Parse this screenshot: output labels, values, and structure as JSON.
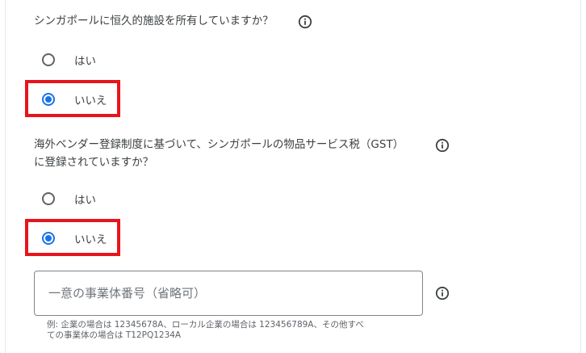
{
  "colors": {
    "accent": "#1a73e8",
    "highlight_border": "#e8141c",
    "text": "#3c4043",
    "secondary_text": "#5f6368"
  },
  "q1": {
    "text": "シンガポールに恒久的施設を所有していますか？",
    "info_icon": "info-icon",
    "options": [
      {
        "label": "はい",
        "selected": false
      },
      {
        "label": "いいえ",
        "selected": true
      }
    ]
  },
  "q2": {
    "line1": "海外ベンダー登録制度に基づいて、シンガポールの物品サービス税（GST）",
    "line2": "に登録されていますか？",
    "info_icon": "info-icon",
    "options": [
      {
        "label": "はい",
        "selected": false
      },
      {
        "label": "いいえ",
        "selected": true
      }
    ]
  },
  "entity_field": {
    "placeholder": "一意の事業体番号（省略可）",
    "value": "",
    "info_icon": "info-icon",
    "helper_line1": "例: 企業の場合は 12345678A、ローカル企業の場合は 123456789A、その他すべ",
    "helper_line2": "ての事業体の場合は T12PQ1234A"
  }
}
